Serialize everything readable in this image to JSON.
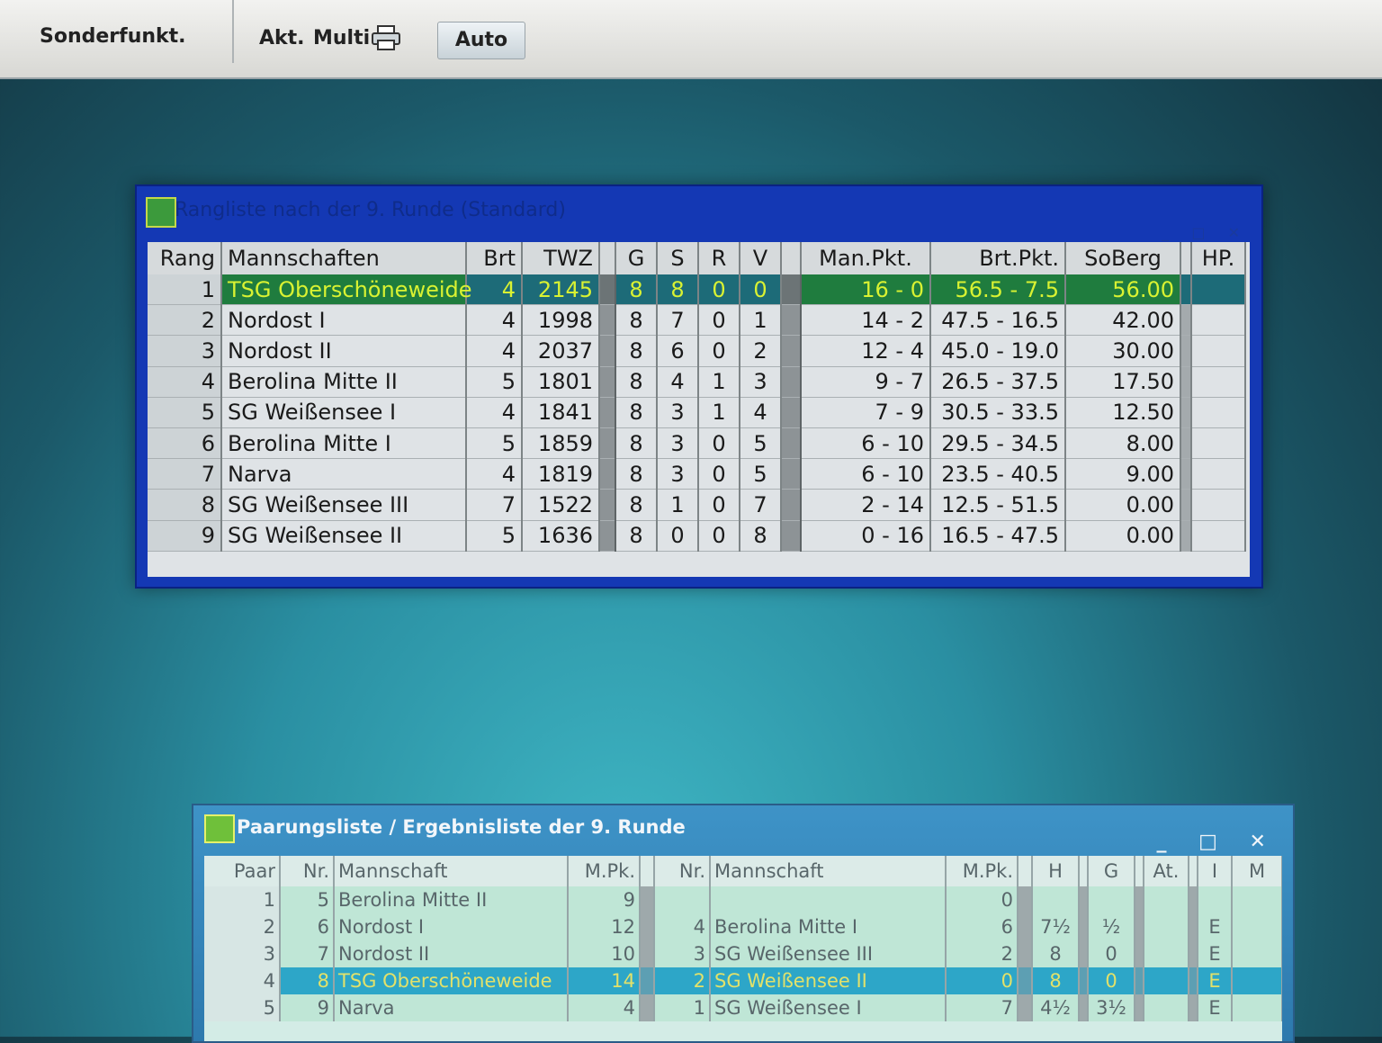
{
  "toolbar": {
    "sonderfunkt": "Sonderfunkt.",
    "akt": "Akt.",
    "multi": "Multi",
    "auto": "Auto"
  },
  "standings": {
    "title": "Rangliste nach der 9. Runde (Standard)",
    "columns": [
      "Rang",
      "Mannschaften",
      "Brt",
      "TWZ",
      "",
      "G",
      "S",
      "R",
      "V",
      "",
      "Man.Pkt.",
      "Brt.Pkt.",
      "SoBerg",
      "",
      "HP."
    ],
    "rows": [
      {
        "rank": "1",
        "team": "TSG Oberschöneweide",
        "brt": "4",
        "twz": "2145",
        "g": "8",
        "s": "8",
        "r": "0",
        "v": "0",
        "man": "16 -   0",
        "brtpkt": "56.5 -   7.5",
        "soberg": "56.00",
        "hp": ""
      },
      {
        "rank": "2",
        "team": "Nordost I",
        "brt": "4",
        "twz": "1998",
        "g": "8",
        "s": "7",
        "r": "0",
        "v": "1",
        "man": "14 -   2",
        "brtpkt": "47.5 -  16.5",
        "soberg": "42.00",
        "hp": ""
      },
      {
        "rank": "3",
        "team": "Nordost II",
        "brt": "4",
        "twz": "2037",
        "g": "8",
        "s": "6",
        "r": "0",
        "v": "2",
        "man": "12 -   4",
        "brtpkt": "45.0 -  19.0",
        "soberg": "30.00",
        "hp": ""
      },
      {
        "rank": "4",
        "team": "Berolina Mitte II",
        "brt": "5",
        "twz": "1801",
        "g": "8",
        "s": "4",
        "r": "1",
        "v": "3",
        "man": "9 -   7",
        "brtpkt": "26.5 -  37.5",
        "soberg": "17.50",
        "hp": ""
      },
      {
        "rank": "5",
        "team": "SG Weißensee I",
        "brt": "4",
        "twz": "1841",
        "g": "8",
        "s": "3",
        "r": "1",
        "v": "4",
        "man": "7 -   9",
        "brtpkt": "30.5 -  33.5",
        "soberg": "12.50",
        "hp": ""
      },
      {
        "rank": "6",
        "team": "Berolina Mitte I",
        "brt": "5",
        "twz": "1859",
        "g": "8",
        "s": "3",
        "r": "0",
        "v": "5",
        "man": "6 -  10",
        "brtpkt": "29.5 -  34.5",
        "soberg": "8.00",
        "hp": ""
      },
      {
        "rank": "7",
        "team": "Narva",
        "brt": "4",
        "twz": "1819",
        "g": "8",
        "s": "3",
        "r": "0",
        "v": "5",
        "man": "6 -  10",
        "brtpkt": "23.5 -  40.5",
        "soberg": "9.00",
        "hp": ""
      },
      {
        "rank": "8",
        "team": "SG Weißensee III",
        "brt": "7",
        "twz": "1522",
        "g": "8",
        "s": "1",
        "r": "0",
        "v": "7",
        "man": "2 -  14",
        "brtpkt": "12.5 -  51.5",
        "soberg": "0.00",
        "hp": ""
      },
      {
        "rank": "9",
        "team": "SG Weißensee II",
        "brt": "5",
        "twz": "1636",
        "g": "8",
        "s": "0",
        "r": "0",
        "v": "8",
        "man": "0 -  16",
        "brtpkt": "16.5 -  47.5",
        "soberg": "0.00",
        "hp": ""
      }
    ]
  },
  "pairings": {
    "title": "Paarungsliste / Ergebnisliste der 9. Runde",
    "columns": [
      "Paar",
      "Nr.",
      "Mannschaft",
      "M.Pk.",
      "",
      "Nr.",
      "Mannschaft",
      "M.Pk.",
      "",
      "H",
      "",
      "G",
      "",
      "At.",
      "",
      "I",
      "M"
    ],
    "rows": [
      {
        "paar": "1",
        "nr1": "5",
        "team1": "Berolina Mitte II",
        "mpk1": "9",
        "nr2": "",
        "team2": "",
        "mpk2": "0",
        "h": "",
        "g": "",
        "at": "",
        "i": "",
        "m": ""
      },
      {
        "paar": "2",
        "nr1": "6",
        "team1": "Nordost I",
        "mpk1": "12",
        "nr2": "4",
        "team2": "Berolina Mitte I",
        "mpk2": "6",
        "h": "7½",
        "g": "½",
        "at": "",
        "i": "E",
        "m": ""
      },
      {
        "paar": "3",
        "nr1": "7",
        "team1": "Nordost II",
        "mpk1": "10",
        "nr2": "3",
        "team2": "SG Weißensee III",
        "mpk2": "2",
        "h": "8",
        "g": "0",
        "at": "",
        "i": "E",
        "m": ""
      },
      {
        "paar": "4",
        "nr1": "8",
        "team1": "TSG Oberschöneweide",
        "mpk1": "14",
        "nr2": "2",
        "team2": "SG Weißensee II",
        "mpk2": "0",
        "h": "8",
        "g": "0",
        "at": "",
        "i": "E",
        "m": ""
      },
      {
        "paar": "5",
        "nr1": "9",
        "team1": "Narva",
        "mpk1": "4",
        "nr2": "1",
        "team2": "SG Weißensee I",
        "mpk2": "7",
        "h": "4½",
        "g": "3½",
        "at": "",
        "i": "E",
        "m": ""
      }
    ]
  }
}
